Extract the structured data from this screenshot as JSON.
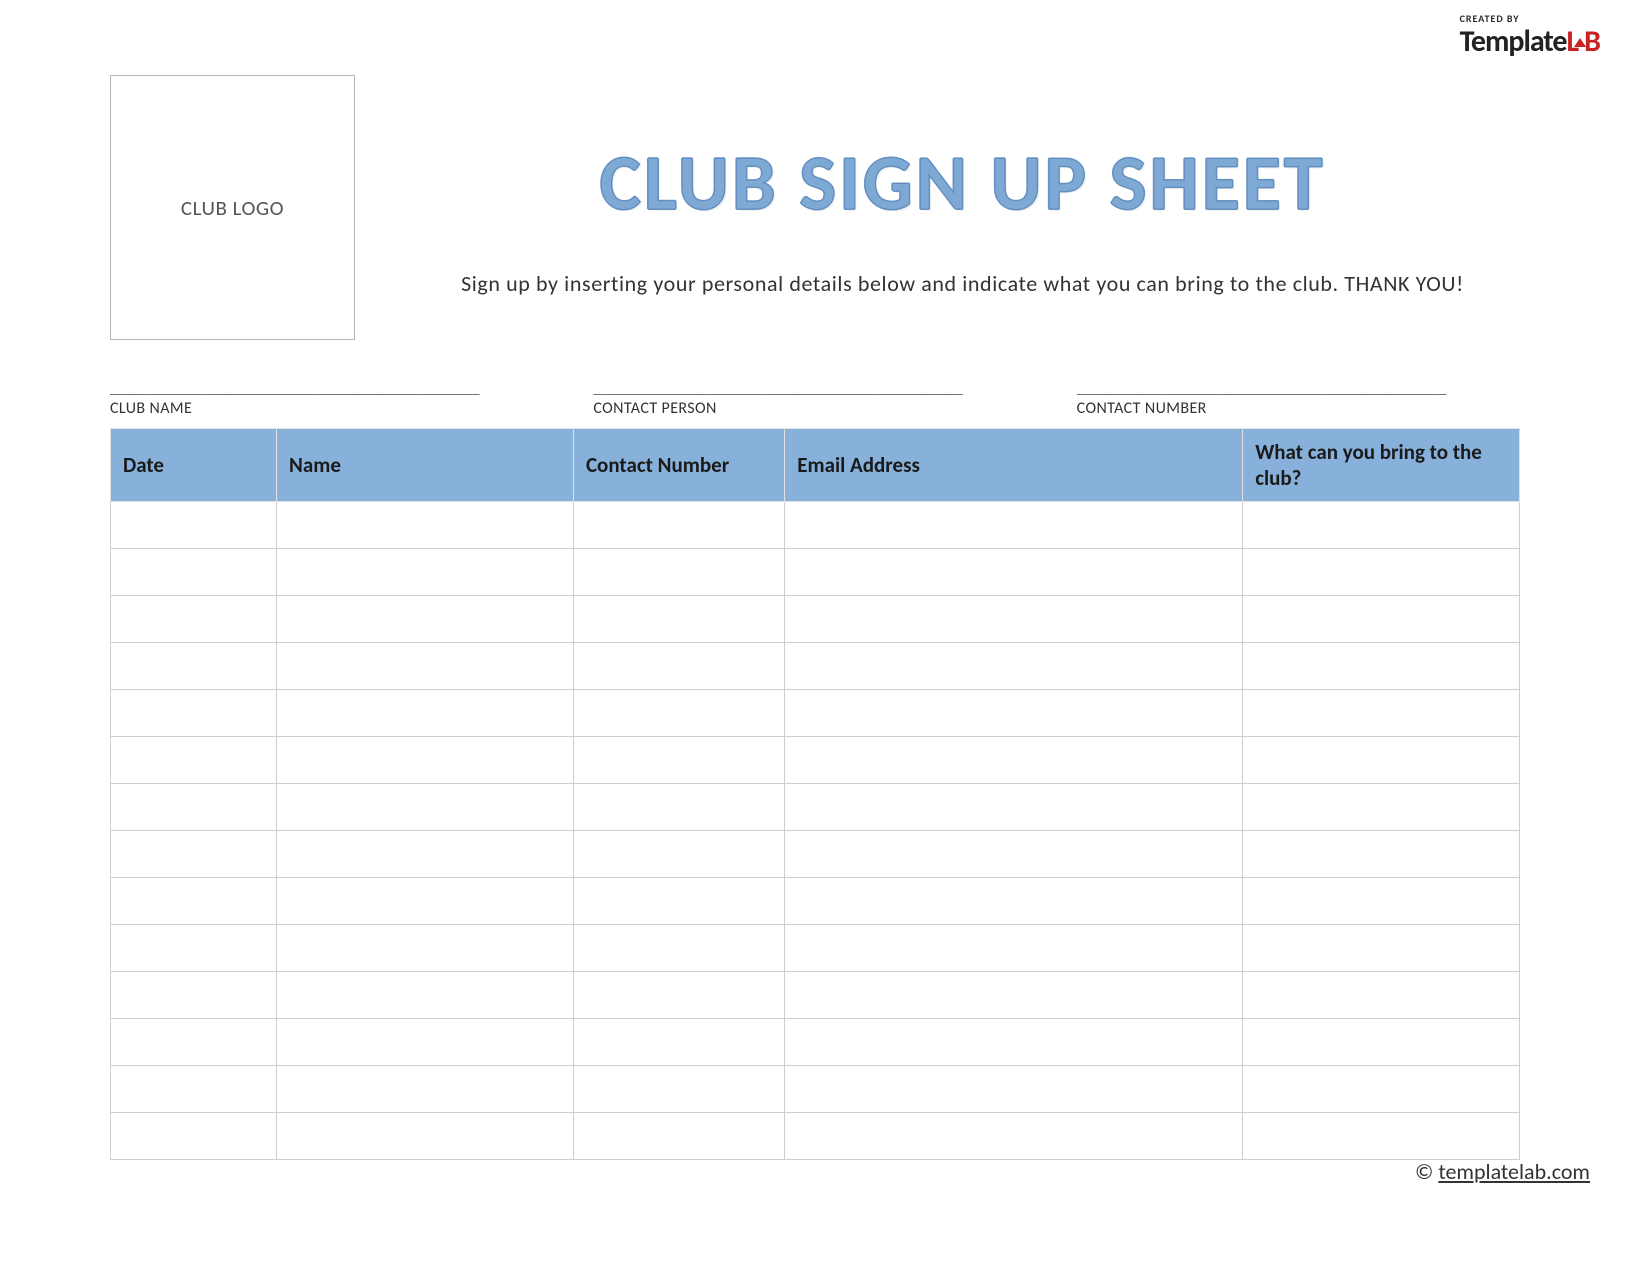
{
  "brand": {
    "created_by": "CREATED BY",
    "name_part1": "Template",
    "name_part2": "L",
    "name_part3": "B"
  },
  "logo_placeholder": "CLUB LOGO",
  "title": "CLUB SIGN UP SHEET",
  "subtitle": "Sign up by inserting your personal details below and indicate what you can bring to the club. THANK YOU!",
  "fields": {
    "line": "_____________________________________________________",
    "club_name_label": "CLUB NAME",
    "contact_person_label": "CONTACT PERSON",
    "contact_number_label": "CONTACT NUMBER"
  },
  "table": {
    "headers": {
      "date": "Date",
      "name": "Name",
      "contact_number": "Contact Number",
      "email": "Email Address",
      "bring": "What can you bring to the club?"
    },
    "row_count": 14
  },
  "footer": {
    "copyright": "©",
    "link_text": "templatelab.com"
  }
}
